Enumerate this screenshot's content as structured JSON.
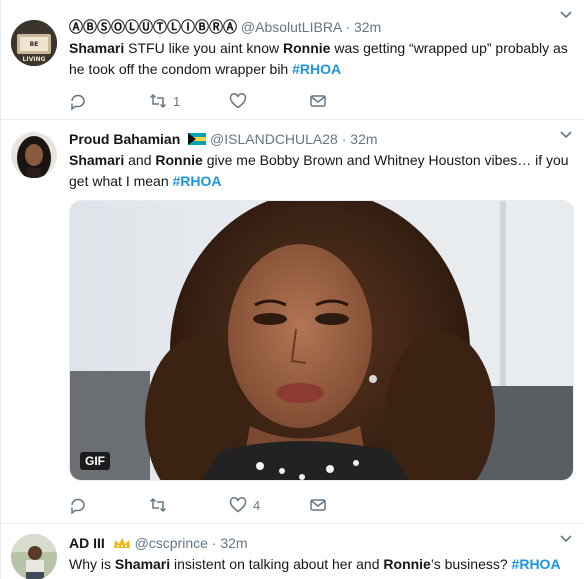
{
  "tweets": [
    {
      "display_name": "ⒶⒷⓈⓄⓁⓊⓉⓁⒾⒷⓇⒶ",
      "handle": "@AbsolutLIBRA",
      "dot": "·",
      "time": "32m",
      "avatar_text_top": "BE",
      "avatar_text_mid": "LIVING",
      "text_parts": [
        {
          "t": "Shamari",
          "b": true
        },
        {
          "t": " STFU like you aint know "
        },
        {
          "t": "Ronnie",
          "b": true
        },
        {
          "t": " was getting “wrapped up” probably as he took off the condom wrapper bih "
        },
        {
          "t": "#RHOA",
          "tag": true
        }
      ],
      "reply_count": "",
      "retweet_count": "1",
      "like_count": ""
    },
    {
      "display_name": "Proud Bahamian",
      "handle": "@ISLANDCHULA28",
      "dot": "·",
      "time": "32m",
      "text_parts": [
        {
          "t": "Shamari",
          "b": true
        },
        {
          "t": " and "
        },
        {
          "t": "Ronnie",
          "b": true
        },
        {
          "t": " give me Bobby Brown and Whitney Houston vibes… if you get what I mean "
        },
        {
          "t": "#RHOA",
          "tag": true
        }
      ],
      "media_badge": "GIF",
      "reply_count": "",
      "retweet_count": "",
      "like_count": "4"
    },
    {
      "display_name": "AD III",
      "handle": "@cscprince",
      "dot": "·",
      "time": "32m",
      "text_parts": [
        {
          "t": "Why is "
        },
        {
          "t": "Shamari",
          "b": true
        },
        {
          "t": " insistent on talking about her and "
        },
        {
          "t": "Ronnie",
          "b": true
        },
        {
          "t": "’s business? "
        },
        {
          "t": "#RHOA",
          "tag": true
        }
      ]
    }
  ],
  "colors": {
    "link": "#1b95e0",
    "secondary": "#657786",
    "border": "#e6ecf0"
  },
  "icons": [
    "reply-icon",
    "retweet-icon",
    "like-icon",
    "dm-icon",
    "caret-down-icon",
    "bahamas-flag-icon",
    "crown-icon"
  ]
}
